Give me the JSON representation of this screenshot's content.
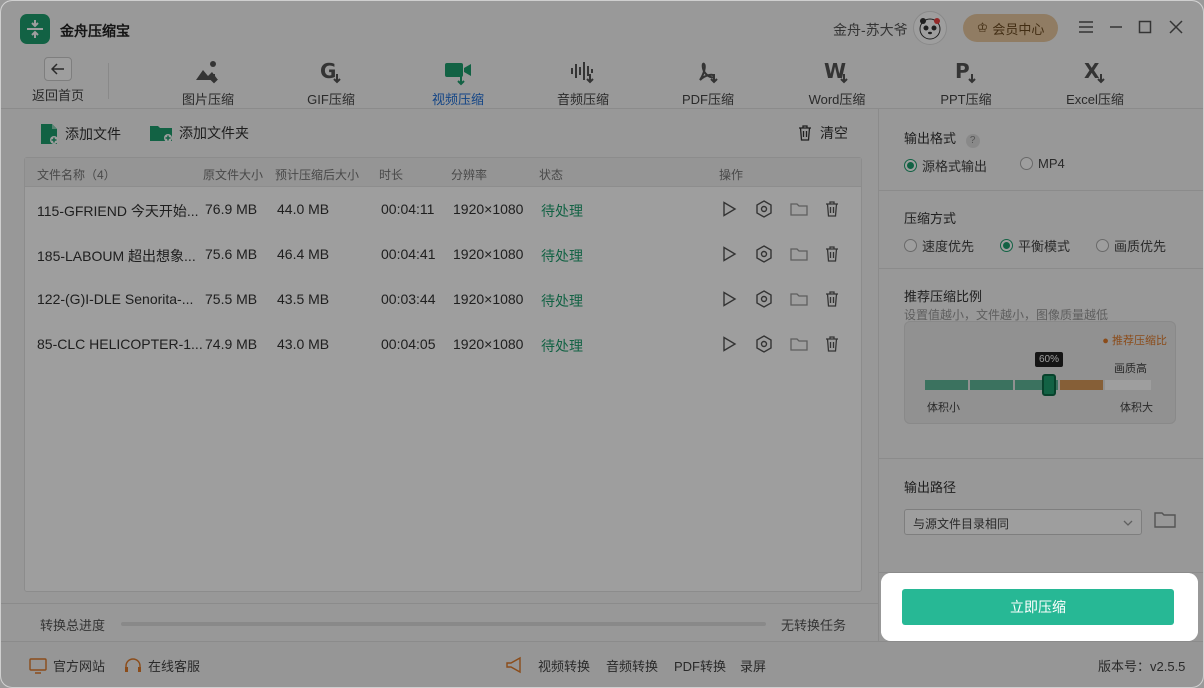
{
  "app": {
    "name": "金舟压缩宝",
    "user": "金舟-苏大爷",
    "vip_label": "会员中心"
  },
  "toolbar": {
    "back_label": "返回首页",
    "tools": [
      {
        "label": "图片压缩",
        "icon": "image-icon"
      },
      {
        "label": "GIF压缩",
        "icon": "gif-icon"
      },
      {
        "label": "视频压缩",
        "icon": "video-icon"
      },
      {
        "label": "音频压缩",
        "icon": "audio-icon"
      },
      {
        "label": "PDF压缩",
        "icon": "pdf-icon"
      },
      {
        "label": "Word压缩",
        "icon": "word-icon"
      },
      {
        "label": "PPT压缩",
        "icon": "ppt-icon"
      },
      {
        "label": "Excel压缩",
        "icon": "excel-icon"
      }
    ],
    "active_tool": "视频压缩"
  },
  "actions": {
    "add_file": "添加文件",
    "add_folder": "添加文件夹",
    "clear": "清空"
  },
  "table": {
    "headers": [
      "文件名称（4）",
      "原文件大小",
      "预计压缩后大小",
      "时长",
      "分辨率",
      "状态",
      "操作"
    ],
    "rows": [
      {
        "name": "115-GFRIEND 今天开始...",
        "size": "76.9 MB",
        "est": "44.0 MB",
        "duration": "00:04:11",
        "res": "1920×1080",
        "status": "待处理"
      },
      {
        "name": "185-LABOUM 超出想象...",
        "size": "75.6 MB",
        "est": "46.4 MB",
        "duration": "00:04:41",
        "res": "1920×1080",
        "status": "待处理"
      },
      {
        "name": "122-(G)I-DLE Senorita-...",
        "size": "75.5 MB",
        "est": "43.5 MB",
        "duration": "00:03:44",
        "res": "1920×1080",
        "status": "待处理"
      },
      {
        "name": "85-CLC HELICOPTER-1...",
        "size": "74.9 MB",
        "est": "43.0 MB",
        "duration": "00:04:05",
        "res": "1920×1080",
        "status": "待处理"
      }
    ]
  },
  "progress": {
    "label": "转换总进度",
    "status": "无转换任务",
    "value": 0
  },
  "settings": {
    "format": {
      "title": "输出格式",
      "options": [
        "源格式输出",
        "MP4"
      ],
      "selected": 0
    },
    "mode": {
      "title": "压缩方式",
      "options": [
        "速度优先",
        "平衡模式",
        "画质优先"
      ],
      "selected": 1
    },
    "ratio": {
      "title": "推荐压缩比例",
      "hint": "设置值越小，文件越小，图像质量越低",
      "recommend": "推荐压缩比",
      "value_label": "60%",
      "value": 60,
      "high_quality": "画质高",
      "small_size": "体积小",
      "large_size": "体积大"
    },
    "output": {
      "title": "输出路径",
      "selected": "与源文件目录相同"
    },
    "start": "立即压缩"
  },
  "footer": {
    "website": "官方网站",
    "service": "在线客服",
    "links": [
      "视频转换",
      "音频转换",
      "PDF转换",
      "录屏"
    ],
    "version": "版本号：v2.5.5"
  },
  "colors": {
    "accent": "#1e9e6e",
    "active_tab": "#1e6fd8",
    "start_button": "#27b895",
    "recommend": "#e07b2a"
  }
}
